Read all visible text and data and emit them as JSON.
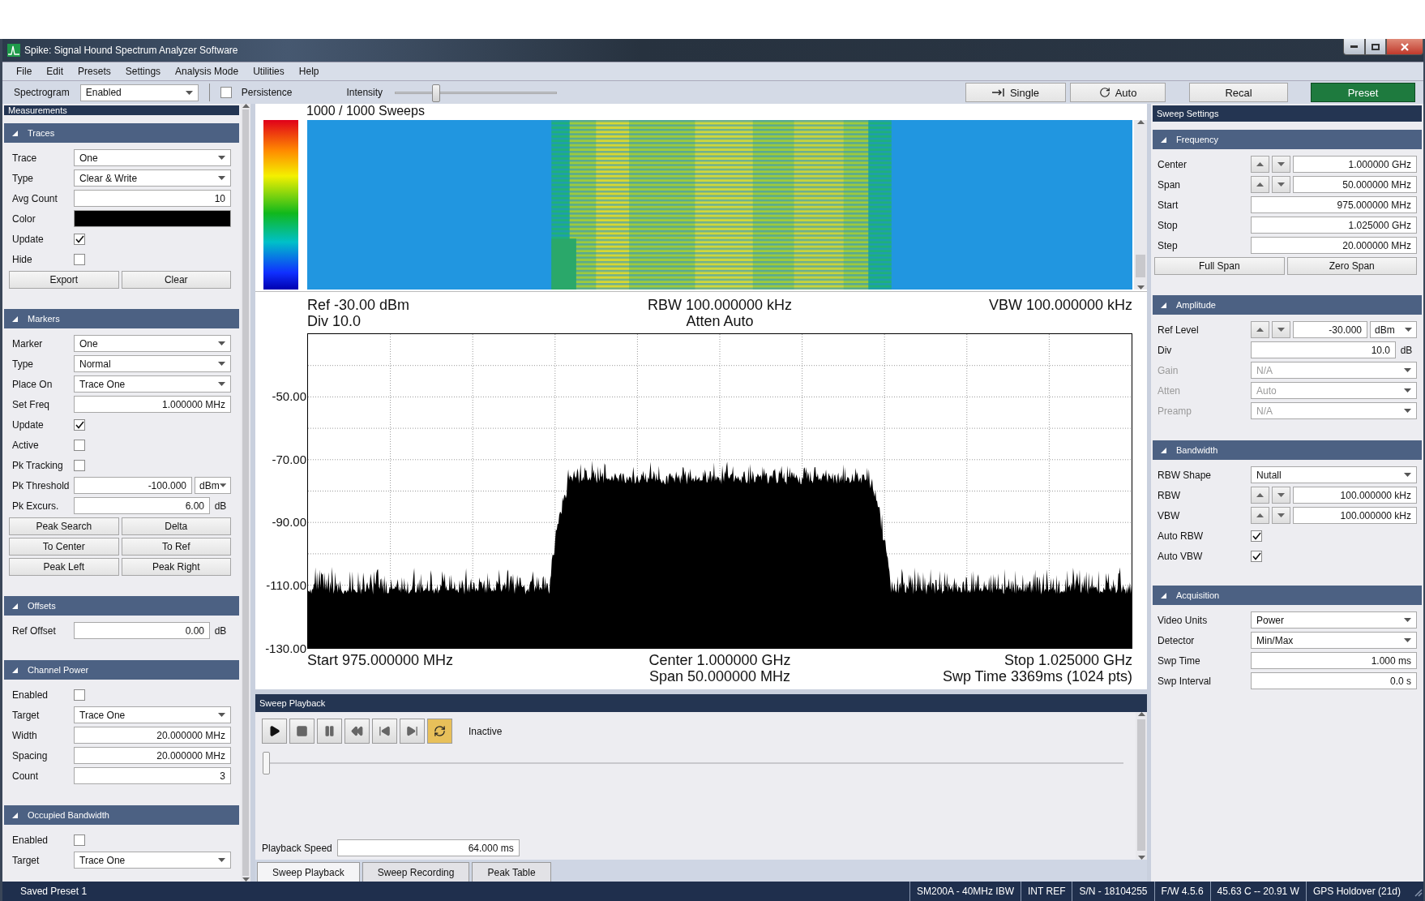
{
  "window": {
    "title": "Spike: Signal Hound Spectrum Analyzer Software"
  },
  "menu": [
    "File",
    "Edit",
    "Presets",
    "Settings",
    "Analysis Mode",
    "Utilities",
    "Help"
  ],
  "toolbar": {
    "spectrogram": {
      "label": "Spectrogram",
      "value": "Enabled"
    },
    "persistence": {
      "label": "Persistence",
      "checked": false
    },
    "intensity": {
      "label": "Intensity",
      "level": 0.25
    },
    "buttons": [
      {
        "kind": "single",
        "label": "Single"
      },
      {
        "kind": "auto",
        "label": "Auto"
      },
      {
        "kind": "plain",
        "label": "Recal"
      },
      {
        "kind": "primary",
        "label": "Preset"
      }
    ]
  },
  "measurements": {
    "title": "Measurements",
    "sections": [
      {
        "title": "Traces",
        "rows": [
          {
            "kind": "select",
            "label": "Trace",
            "value": "One"
          },
          {
            "kind": "select",
            "label": "Type",
            "value": "Clear & Write"
          },
          {
            "kind": "input",
            "label": "Avg Count",
            "value": "10"
          },
          {
            "kind": "color",
            "label": "Color",
            "color": "#000000"
          },
          {
            "kind": "checkbox",
            "label": "Update",
            "checked": true
          },
          {
            "kind": "checkbox",
            "label": "Hide",
            "checked": false
          },
          {
            "kind": "buttons",
            "buttons": [
              "Export",
              "Clear"
            ]
          }
        ]
      },
      {
        "title": "Markers",
        "rows": [
          {
            "kind": "select",
            "label": "Marker",
            "value": "One"
          },
          {
            "kind": "select",
            "label": "Type",
            "value": "Normal"
          },
          {
            "kind": "select",
            "label": "Place On",
            "value": "Trace One"
          },
          {
            "kind": "input",
            "label": "Set Freq",
            "value": "1.000000 MHz"
          },
          {
            "kind": "checkbox",
            "label": "Update",
            "checked": true
          },
          {
            "kind": "checkbox",
            "label": "Active",
            "checked": false
          },
          {
            "kind": "checkbox",
            "label": "Pk Tracking",
            "checked": false
          },
          {
            "kind": "input_select",
            "label": "Pk Threshold",
            "value": "-100.000",
            "unit": "dBm"
          },
          {
            "kind": "input",
            "label": "Pk Excurs.",
            "value": "6.00",
            "unit": "dB"
          },
          {
            "kind": "buttons",
            "buttons": [
              "Peak Search",
              "Delta"
            ]
          },
          {
            "kind": "buttons",
            "buttons": [
              "To Center",
              "To Ref"
            ]
          },
          {
            "kind": "buttons",
            "buttons": [
              "Peak Left",
              "Peak Right"
            ]
          }
        ]
      },
      {
        "title": "Offsets",
        "rows": [
          {
            "kind": "input",
            "label": "Ref Offset",
            "value": "0.00",
            "unit": "dB"
          }
        ]
      },
      {
        "title": "Channel Power",
        "rows": [
          {
            "kind": "checkbox",
            "label": "Enabled",
            "checked": false
          },
          {
            "kind": "select",
            "label": "Target",
            "value": "Trace One"
          },
          {
            "kind": "input",
            "label": "Width",
            "value": "20.000000 MHz"
          },
          {
            "kind": "input",
            "label": "Spacing",
            "value": "20.000000 MHz"
          },
          {
            "kind": "input",
            "label": "Count",
            "value": "3"
          }
        ]
      },
      {
        "title": "Occupied Bandwidth",
        "rows": [
          {
            "kind": "checkbox",
            "label": "Enabled",
            "checked": false
          },
          {
            "kind": "select",
            "label": "Target",
            "value": "Trace One"
          }
        ]
      }
    ]
  },
  "spectrogram": {
    "caption": "1000 / 1000 Sweeps"
  },
  "spectrum": {
    "header": {
      "ref": "Ref -30.00 dBm",
      "div": "Div 10.0",
      "rbw": "RBW 100.000000 kHz",
      "atten": "Atten Auto",
      "vbw": "VBW 100.000000 kHz"
    },
    "y_labels": [
      "-50.00",
      "-70.00",
      "-90.00",
      "-110.00",
      "-130.00"
    ],
    "footer": {
      "start": "Start 975.000000 MHz",
      "center": "Center 1.000000 GHz",
      "span": "Span 50.000000 MHz",
      "stop": "Stop 1.025000 GHz",
      "swp_time": "Swp Time 3369ms (1024 pts)"
    }
  },
  "sweep_playback": {
    "title": "Sweep Playback",
    "controls": [
      {
        "kind": "play",
        "active": false
      },
      {
        "kind": "stop",
        "active": false
      },
      {
        "kind": "pause",
        "active": false
      },
      {
        "kind": "rewind",
        "active": false
      },
      {
        "kind": "previous",
        "active": false
      },
      {
        "kind": "next",
        "active": false
      },
      {
        "kind": "loop",
        "active": true
      }
    ],
    "status": "Inactive",
    "position": {
      "level": 0
    },
    "speed": {
      "label": "Playback Speed",
      "value": "64.000 ms"
    }
  },
  "bottom_tabs": [
    {
      "label": "Sweep Playback",
      "selected": true
    },
    {
      "label": "Sweep Recording",
      "selected": false
    },
    {
      "label": "Peak Table",
      "selected": false
    }
  ],
  "sweep_settings": {
    "title": "Sweep Settings",
    "sections": [
      {
        "title": "Frequency",
        "rows": [
          {
            "kind": "spin",
            "label": "Center",
            "value": "1.000000 GHz"
          },
          {
            "kind": "spin",
            "label": "Span",
            "value": "50.000000 MHz"
          },
          {
            "kind": "input",
            "label": "Start",
            "value": "975.000000 MHz"
          },
          {
            "kind": "input",
            "label": "Stop",
            "value": "1.025000 GHz"
          },
          {
            "kind": "input",
            "label": "Step",
            "value": "20.000000 MHz"
          },
          {
            "kind": "buttons",
            "buttons": [
              "Full Span",
              "Zero Span"
            ]
          }
        ]
      },
      {
        "title": "Amplitude",
        "rows": [
          {
            "kind": "spin",
            "label": "Ref Level",
            "value": "-30.000",
            "unit": "dBm",
            "disabled": false
          },
          {
            "kind": "input",
            "label": "Div",
            "value": "10.0",
            "unit": "dB",
            "disabled": false
          },
          {
            "kind": "select",
            "label": "Gain",
            "value": "N/A",
            "disabled": true
          },
          {
            "kind": "select",
            "label": "Atten",
            "value": "Auto",
            "disabled": true
          },
          {
            "kind": "select",
            "label": "Preamp",
            "value": "N/A",
            "disabled": true
          }
        ]
      },
      {
        "title": "Bandwidth",
        "rows": [
          {
            "kind": "select",
            "label": "RBW Shape",
            "value": "Nutall"
          },
          {
            "kind": "spin",
            "label": "RBW",
            "value": "100.000000 kHz"
          },
          {
            "kind": "spin",
            "label": "VBW",
            "value": "100.000000 kHz"
          },
          {
            "kind": "checkbox",
            "label": "Auto RBW",
            "checked": true
          },
          {
            "kind": "checkbox",
            "label": "Auto VBW",
            "checked": true
          }
        ]
      },
      {
        "title": "Acquisition",
        "rows": [
          {
            "kind": "select",
            "label": "Video Units",
            "value": "Power"
          },
          {
            "kind": "select",
            "label": "Detector",
            "value": "Min/Max"
          },
          {
            "kind": "input",
            "label": "Swp Time",
            "value": "1.000 ms"
          },
          {
            "kind": "input",
            "label": "Swp Interval",
            "value": "0.0 s"
          }
        ]
      }
    ]
  },
  "status_bar": {
    "message": "Saved Preset 1",
    "fields": [
      "SM200A - 40MHz IBW",
      "INT REF",
      "S/N - 18104255",
      "F/W 4.5.6",
      "45.63 C -- 20.91 W",
      "GPS Holdover (21d)"
    ]
  }
}
